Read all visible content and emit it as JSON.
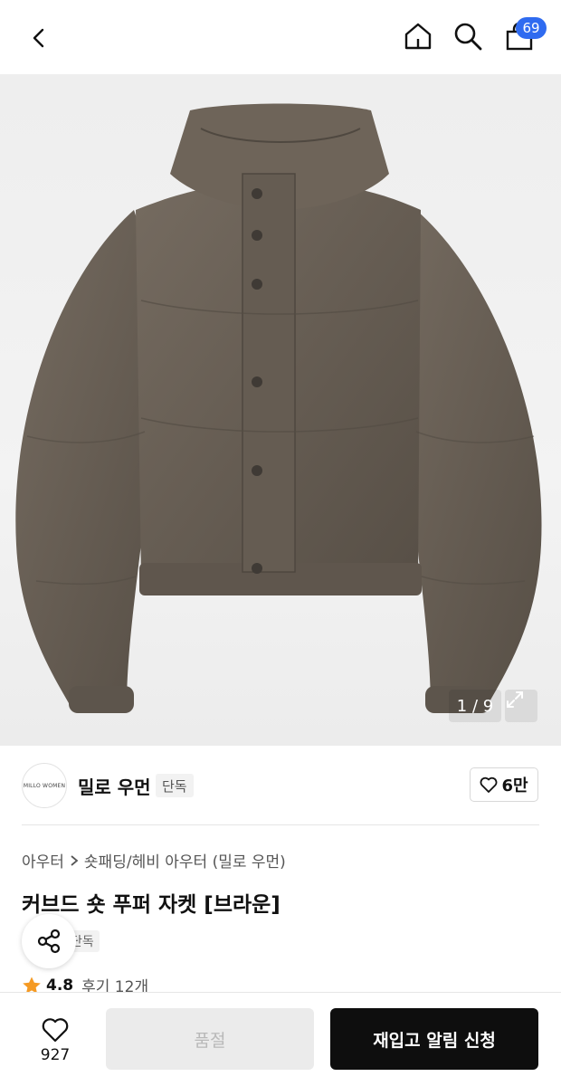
{
  "header": {
    "back_icon": "chevron-left-icon",
    "home_icon": "home-icon",
    "search_icon": "search-icon",
    "cart_icon": "shopping-bag-icon",
    "cart_badge": "69",
    "badge_color": "#2f6bf0"
  },
  "gallery": {
    "counter": "1 / 9",
    "expand_icon": "expand-icon",
    "jacket_color": "#6a6056"
  },
  "brand": {
    "logo_text": "MILLO WOMEN",
    "name": "밀로 우먼",
    "tag": "단독",
    "like_count": "6만"
  },
  "product": {
    "breadcrumb": [
      "아우터",
      "숏패딩/헤비 아우터 (밀로 우먼)"
    ],
    "title": "커브드 숏 푸퍼 자켓 [브라운]",
    "tag": "단독",
    "rating": "4.8",
    "reviews": "후기 12개",
    "star_color": "#f59a23"
  },
  "bottom": {
    "wish_count": "927",
    "soldout_label": "품절",
    "restock_label": "재입고 알림 신청"
  }
}
